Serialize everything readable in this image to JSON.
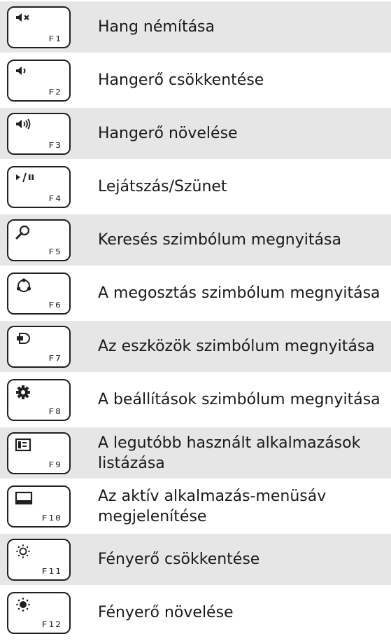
{
  "rows": [
    {
      "key": "F1",
      "icon": "mute-icon",
      "label": "Hang némítása"
    },
    {
      "key": "F2",
      "icon": "volume-down-icon",
      "label": "Hangerő csökkentése"
    },
    {
      "key": "F3",
      "icon": "volume-up-icon",
      "label": "Hangerő növelése"
    },
    {
      "key": "F4",
      "icon": "play-pause-icon",
      "label": "Lejátszás/Szünet"
    },
    {
      "key": "F5",
      "icon": "search-icon",
      "label": "Keresés szimbólum megnyitása"
    },
    {
      "key": "F6",
      "icon": "share-icon",
      "label": "A megosztás szimbólum megnyitása"
    },
    {
      "key": "F7",
      "icon": "devices-icon",
      "label": "Az eszközök szimbólum megnyitása"
    },
    {
      "key": "F8",
      "icon": "settings-gear-icon",
      "label": "A beállítások szimbólum megnyitása"
    },
    {
      "key": "F9",
      "icon": "recent-apps-icon",
      "label": "A legutóbb használt alkalmazások listázása"
    },
    {
      "key": "F10",
      "icon": "app-bar-icon",
      "label": "Az aktív alkalmazás-menüsáv megjelenítése"
    },
    {
      "key": "F11",
      "icon": "brightness-down-icon",
      "label": "Fényerő csökkentése"
    },
    {
      "key": "F12",
      "icon": "brightness-up-icon",
      "label": "Fényerő növelése"
    }
  ],
  "play_pause_glyph": "▸/⏸",
  "colors": {
    "row_shade": "#e6e6e6",
    "row_plain": "#ffffff",
    "key_border": "#231f20",
    "text": "#1a1a1a"
  }
}
